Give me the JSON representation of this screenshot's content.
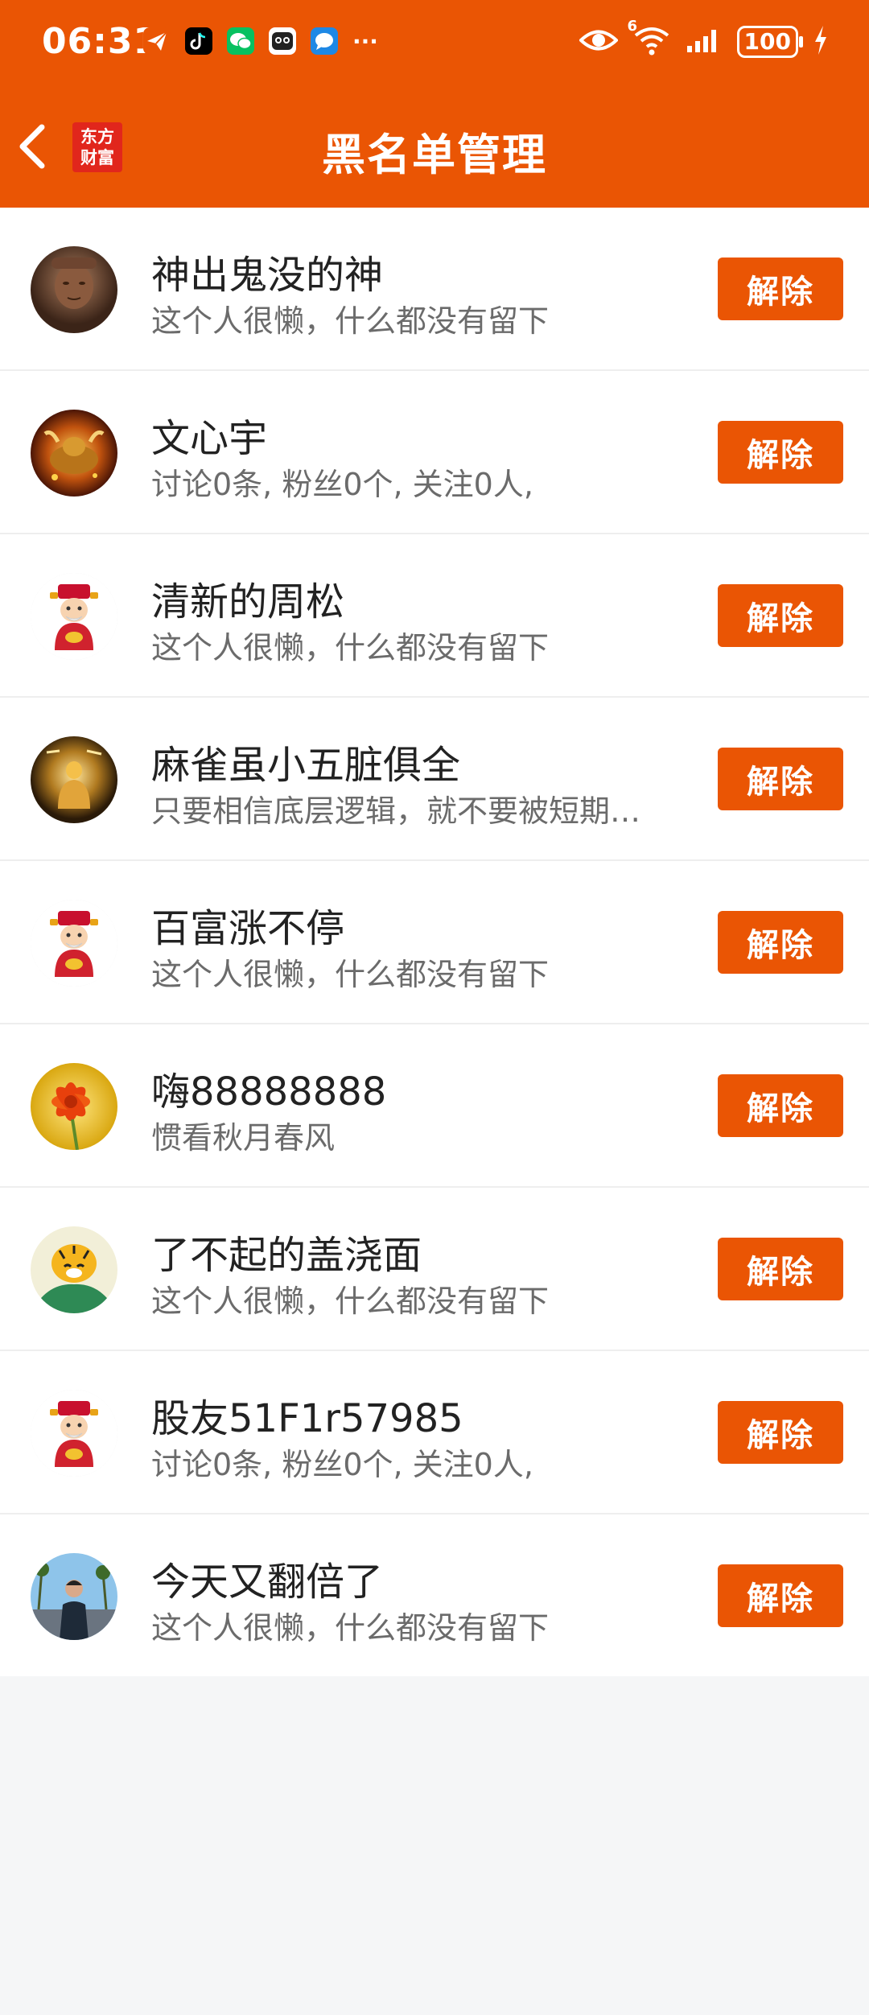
{
  "status_bar": {
    "time": "06:31",
    "network": "6",
    "battery": "100",
    "notif_icons": [
      "paper-plane-icon",
      "tiktok-icon",
      "wechat-icon",
      "game-icon",
      "message-icon"
    ],
    "more": "···"
  },
  "header": {
    "title": "黑名单管理",
    "logo_line1": "东方",
    "logo_line2": "财富"
  },
  "remove_label": "解除",
  "users": [
    {
      "name": "神出鬼没的神",
      "desc": "这个人很懒，什么都没有留下",
      "avatar": "statue-avatar"
    },
    {
      "name": "文心宇",
      "desc": "讨论0条, 粉丝0个, 关注0人,",
      "avatar": "golden-bull-avatar"
    },
    {
      "name": "清新的周松",
      "desc": "这个人很懒，什么都没有留下",
      "avatar": "fortune-god-avatar"
    },
    {
      "name": "麻雀虽小五脏俱全",
      "desc": " 只要相信底层逻辑，就不要被短期…",
      "avatar": "golden-buddha-avatar"
    },
    {
      "name": "百富涨不停",
      "desc": "这个人很懒，什么都没有留下",
      "avatar": "fortune-god-avatar"
    },
    {
      "name": "嗨88888888",
      "desc": "惯看秋月春风",
      "avatar": "red-flower-avatar"
    },
    {
      "name": "了不起的盖浇面",
      "desc": "这个人很懒，什么都没有留下",
      "avatar": "tiger-avatar"
    },
    {
      "name": "股友51F1r57985",
      "desc": "讨论0条, 粉丝0个, 关注0人,",
      "avatar": "fortune-god-avatar"
    },
    {
      "name": "今天又翻倍了",
      "desc": "这个人很懒，什么都没有留下",
      "avatar": "person-photo-avatar"
    }
  ],
  "colors": {
    "brand_orange": "#ea5504",
    "logo_red": "#e1261c",
    "background": "#f5f6f7"
  }
}
